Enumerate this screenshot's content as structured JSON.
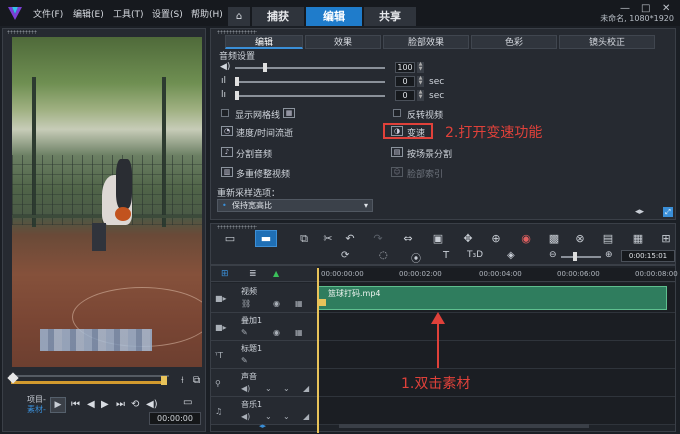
{
  "menu": {
    "file": "文件(F)",
    "edit": "编辑(E)",
    "tools": "工具(T)",
    "settings": "设置(S)",
    "help": "帮助(H)"
  },
  "nav": {
    "home_icon": "home-icon",
    "tabs": [
      "捕获",
      "编辑",
      "共享"
    ],
    "active": "编辑"
  },
  "window": {
    "minimize": "—",
    "restore": "□",
    "close": "✕"
  },
  "project": {
    "name": "未命名, 1080*1920"
  },
  "left": {
    "project_label": "项目-",
    "clip_label": "素材-",
    "timecode": "00:00:00"
  },
  "options": {
    "tabs": [
      "编辑",
      "效果",
      "脸部效果",
      "色彩",
      "镜头校正"
    ],
    "audio_section": "音频设置",
    "volume": "100",
    "fade_in": "0",
    "fade_out": "0",
    "sec1": "sec",
    "sec2": "sec",
    "show_grid": "显示网格线",
    "reverse": "反转视频",
    "speed_timelapse": "速度/时间流逝",
    "speed": "变速",
    "split_audio": "分割音频",
    "split_scene": "按场景分割",
    "multi_trim": "多重修整视频",
    "face_index": "脸部索引",
    "resample_label": "重新采样选项：",
    "resample_value": "保持宽高比"
  },
  "annotations": {
    "step2": "2.打开变速功能",
    "step1": "1.双击素材"
  },
  "colors": {
    "accent": "#1f7ccb",
    "annotation": "#e0413a",
    "clip": "#2f7d5e",
    "playhead": "#e8c35a"
  },
  "toolbar": {
    "timecode": "0:00:15:01"
  },
  "timeline": {
    "ruler": [
      "00:00:00:00",
      "00:00:02:00",
      "00:00:04:00",
      "00:00:06:00",
      "00:00:08:00"
    ],
    "tracks": [
      "视频",
      "叠加1",
      "标题1",
      "声音",
      "音乐1"
    ],
    "clip_name": "篮球打码.mp4"
  }
}
